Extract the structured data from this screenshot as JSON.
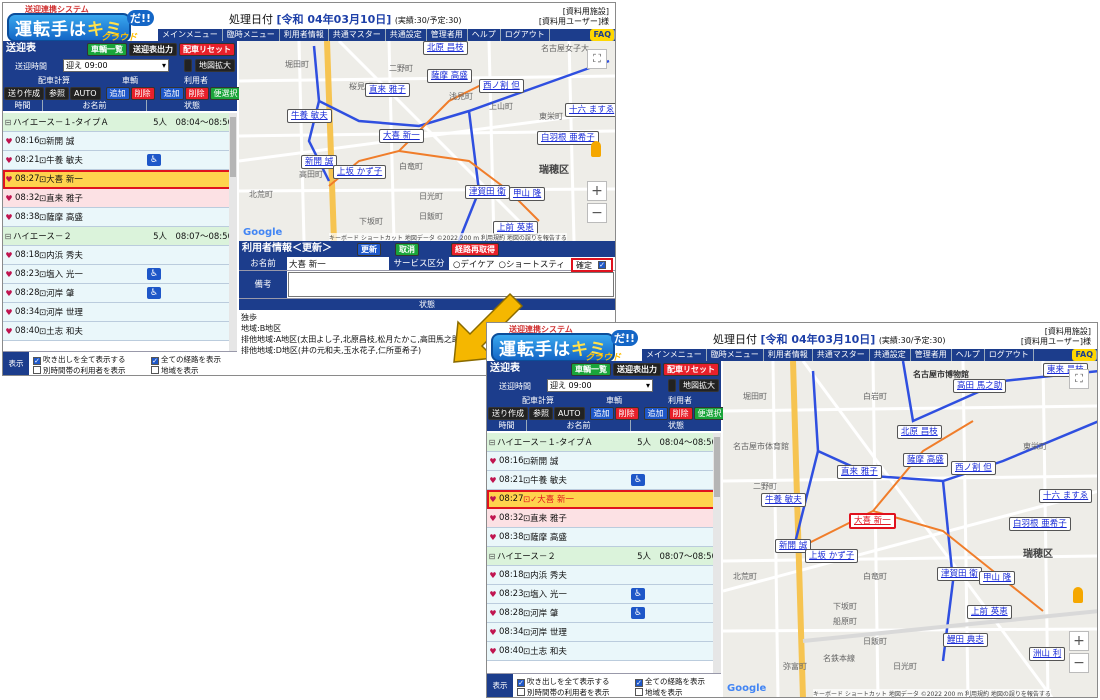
{
  "app": {
    "logo_tag": "送迎連携システム",
    "logo_main_a": "運転手は",
    "logo_main_b": "キミ",
    "logo_dane": "だ!!",
    "logo_cloud": "クラウド",
    "date_label": "処理日付",
    "date_value": "[令和 04年03月10日]",
    "date_sub": "(実績:30/予定:30)",
    "user_line1": "[資料用施設]",
    "user_line2": "[資料用ユーザー]様"
  },
  "menu": [
    "メインメニュー",
    "臨時メニュー",
    "利用者情報",
    "共通マスター",
    "共通設定",
    "管理者用",
    "ヘルプ",
    "ログアウト"
  ],
  "menu_faq": "FAQ",
  "left": {
    "title": "送迎表",
    "btn_vehicles": "車輌一覧",
    "btn_output": "送迎表出力",
    "btn_reset": "配車リセット",
    "time_label": "送迎時間",
    "time_value": "迎え 09:00",
    "btn_zoom": "地図拡大",
    "grp_calc": "配車計算",
    "grp_vehicle": "車輌",
    "grp_user": "利用者",
    "btn_create": "送り作成",
    "btn_ref": "参照",
    "btn_auto": "AUTO",
    "btn_add_v": "追加",
    "btn_del_v": "削除",
    "btn_add_u": "追加",
    "btn_del_u": "削除",
    "btn_select": "便選択",
    "col_time": "時間",
    "col_name": "お名前",
    "col_status": "状態"
  },
  "rows": [
    {
      "type": "veh",
      "name": "ハイエース－１-タイプＡ",
      "count": "5人",
      "range": "08:04〜08:50"
    },
    {
      "type": "pass",
      "time": "08:16",
      "name": "新開 誠",
      "wc": false
    },
    {
      "type": "pass",
      "time": "08:21",
      "name": "牛養 敏夫",
      "wc": true
    },
    {
      "type": "sel",
      "time": "08:27",
      "name": "大喜 新一",
      "name_b": "✓大喜 新一",
      "wc": false
    },
    {
      "type": "pink",
      "time": "08:32",
      "name": "直来 雅子",
      "wc": false
    },
    {
      "type": "pass",
      "time": "08:38",
      "name": "薩摩 高盛",
      "wc": false
    },
    {
      "type": "veh",
      "name": "ハイエース－２",
      "count": "5人",
      "range": "08:07〜08:50"
    },
    {
      "type": "pass",
      "time": "08:18",
      "name": "内浜 秀夫",
      "wc": false
    },
    {
      "type": "pass",
      "time": "08:23",
      "name": "塩入 光一",
      "wc": true
    },
    {
      "type": "pass",
      "time": "08:28",
      "name": "河岸 肇",
      "wc": true
    },
    {
      "type": "pass",
      "time": "08:34",
      "name": "河岸 世理",
      "wc": false
    },
    {
      "type": "pass",
      "time": "08:40",
      "name": "土志 和夫",
      "wc": false
    }
  ],
  "bottom": {
    "disp": "表示",
    "opt1": "吹き出しを全て表示する",
    "opt2": "全ての経路を表示",
    "opt3": "別時間帯の利用者を表示",
    "opt4": "地域を表示"
  },
  "info": {
    "title": "利用者情報＜更新＞",
    "btn_update": "更新",
    "btn_cancel": "取消",
    "btn_reroute": "経路再取得",
    "k_name": "お名前",
    "v_name": "大喜 新一",
    "k_service": "サービス区分",
    "opt_day": "デイケア",
    "opt_short": "ショートスティ",
    "confirm": "確定",
    "k_memo": "備考",
    "status_hdr": "状態",
    "status1": "独歩",
    "status2": "地域:B地区",
    "status3": "排他地域:A地区(太田よし子,北原昌枝,松月たかこ,高田馬之助)",
    "status4": "排他地域:D地区(井の元和夫,玉水花子,仁所亜希子)"
  },
  "map": {
    "pins_a": [
      "北原 昌枝",
      "薩摩 高盛",
      "直来 雅子",
      "西ノ割 但",
      "牛養 敏夫",
      "大喜 新一",
      "白羽根 亜希子",
      "十六 ますゑ",
      "新開 誠",
      "上坂 かず子",
      "津賀田 衛",
      "甲山 隆",
      "上前 英恵"
    ],
    "pins_b": [
      "高田 馬之助",
      "東来 昌枝",
      "北原 昌枝",
      "薩摩 高盛",
      "直来 雅子",
      "西ノ割 但",
      "牛養 敏夫",
      "十六 ますゑ",
      "大喜 新一",
      "白羽根 亜希子",
      "新開 誠",
      "上坂 かず子",
      "津賀田 衛",
      "甲山 隆",
      "上前 英恵",
      "鯉田 典志",
      "洲山 利"
    ],
    "places_a": [
      "堀田町",
      "二野町",
      "桜見町",
      "名古屋女子大",
      "東栄町",
      "上山町",
      "浅見町",
      "瑞穂区",
      "下坂町",
      "白竜町",
      "日飯町",
      "日光町",
      "北荒町",
      "高田町"
    ],
    "places_b": [
      "堀田町",
      "名古屋市博物館",
      "名古屋市体育館",
      "東栄町",
      "二野町",
      "白岩町",
      "瑞穂区",
      "北荒町",
      "白竜町",
      "下坂町",
      "日飯町",
      "日光町",
      "弥富町",
      "船原町",
      "名鉄本線"
    ],
    "google": "Google",
    "copyright": "キーボード ショートカット 地図データ ©2022 200 m 利用規約 地図の誤りを報告する",
    "zoom_in": "+",
    "zoom_out": "−",
    "fullscreen": "⛶"
  }
}
